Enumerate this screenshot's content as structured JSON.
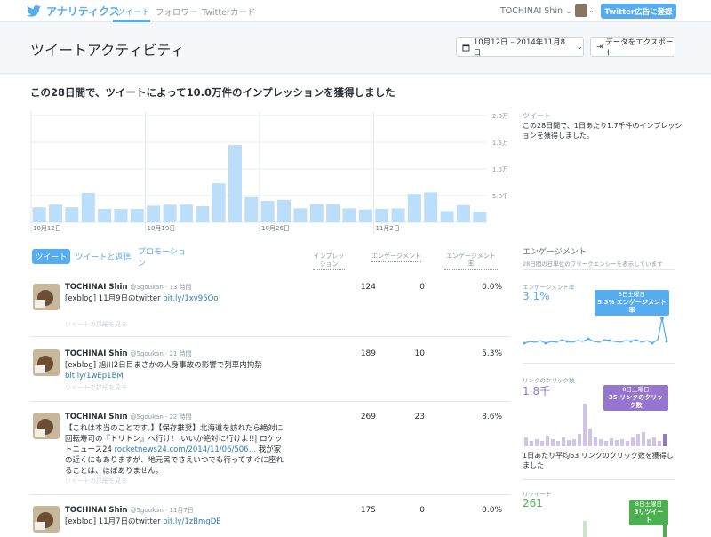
{
  "nav": {
    "brand": "アナリティクス",
    "links": [
      "ツイート",
      "フォロワー",
      "Twitterカード"
    ],
    "user": "TOCHINAI Shin",
    "ads_button": "Twitter広告に登録"
  },
  "header": {
    "title": "ツイートアクティビティ",
    "date_range": "10月12日 – 2014年11月8日",
    "export": "データをエクスポート"
  },
  "summary": "この28日間で、ツイートによって10.0万件のインプレッションを獲得しました",
  "side": {
    "title": "ツイート",
    "desc": "この28日間で、1日あたり1.7千件のインプレッションを獲得しました。"
  },
  "chart_data": {
    "type": "bar",
    "categories": [
      "10月12日",
      "",
      "",
      "",
      "",
      "",
      "",
      "10月19日",
      "",
      "",
      "",
      "",
      "",
      "",
      "10月26日",
      "",
      "",
      "",
      "",
      "",
      "",
      "11月2日",
      "",
      "",
      "",
      "",
      "",
      ""
    ],
    "x_tick_labels": [
      "10月12日",
      "10月19日",
      "10月26日",
      "11月2日"
    ],
    "values": [
      0.28,
      0.33,
      0.28,
      0.55,
      0.25,
      0.25,
      0.25,
      0.31,
      0.33,
      0.33,
      0.3,
      0.73,
      1.45,
      0.47,
      0.4,
      0.42,
      0.26,
      0.34,
      0.34,
      0.26,
      0.24,
      0.25,
      0.26,
      0.53,
      0.56,
      0.21,
      0.32,
      0.19
    ],
    "unit": "万",
    "y_ticks": [
      "2.0万",
      "1.5万",
      "1.0万",
      "5.0千"
    ],
    "ylim": [
      0,
      2.0
    ],
    "color": "#bbdefb"
  },
  "tabs": [
    "ツイート",
    "ツイートと返信",
    "プロモーション"
  ],
  "columns": [
    "インプレッション",
    "エンゲージメント",
    "エンゲージメント率"
  ],
  "tweets": [
    {
      "name": "TOCHINAI Shin",
      "handle": "@5goukan · 13 時間",
      "text": "[exblog] 11月9日のtwitter ",
      "link": "bit.ly/1xv95Qo",
      "detail": "ツイートの詳細を見る",
      "impressions": "124",
      "engagements": "0",
      "rate": "0.0%"
    },
    {
      "name": "TOCHINAI Shin",
      "handle": "@5goukan · 21 時間",
      "text": "[exblog] 旭川2日目まさかの人身事故の影響で列車内拘禁 ",
      "link": "bit.ly/1wEp1BM",
      "detail": "ツイートの詳細を見る",
      "impressions": "189",
      "engagements": "10",
      "rate": "5.3%"
    },
    {
      "name": "TOCHINAI Shin",
      "handle": "@5goukan · 22 時間",
      "text": "【これは本当のことです。】【保存推奨】北海道を訪れたら絶対に回転寿司の『トリトン』へ行け！ いいか絶対に行けよ!!| ロケットニュース24 ",
      "link": "rocketnews24.com/2014/11/06/506…",
      "text2": " 我が家の近くにもありますが、地元民でさえいつでも行ってすぐに座れることは、ほぼありません。",
      "detail": "ツイートの詳細を見る",
      "impressions": "269",
      "engagements": "23",
      "rate": "8.6%"
    },
    {
      "name": "TOCHINAI Shin",
      "handle": "@5goukan · 11月7日",
      "text": "[exblog] 11月7日のtwitter ",
      "link": "bit.ly/1zBmgDE",
      "detail": "",
      "impressions": "175",
      "engagements": "0",
      "rate": "0.0%"
    }
  ],
  "right": {
    "title": "エンゲージメント",
    "sub": "28日間の日単位のフリークエンシーを表示しています",
    "rate_label": "エンゲージメント率",
    "rate_value": "3.1%",
    "rate_tip_date": "8日土曜日",
    "rate_tip": "5.3% エンゲージメント率",
    "click_label": "リンクのクリック数",
    "click_value": "1.8千",
    "click_tip_date": "8日土曜日",
    "click_tip": "35 リンクのクリック数",
    "click_desc": "1日あたり平均63 リンクのクリック数を獲得しました",
    "rt_label": "リツイート",
    "rt_value": "261",
    "rt_tip_date": "8日土曜日",
    "rt_tip": "3リツイート",
    "rate_color": "#55acee",
    "click_color": "#9575cd",
    "rt_color": "#4caf50"
  }
}
